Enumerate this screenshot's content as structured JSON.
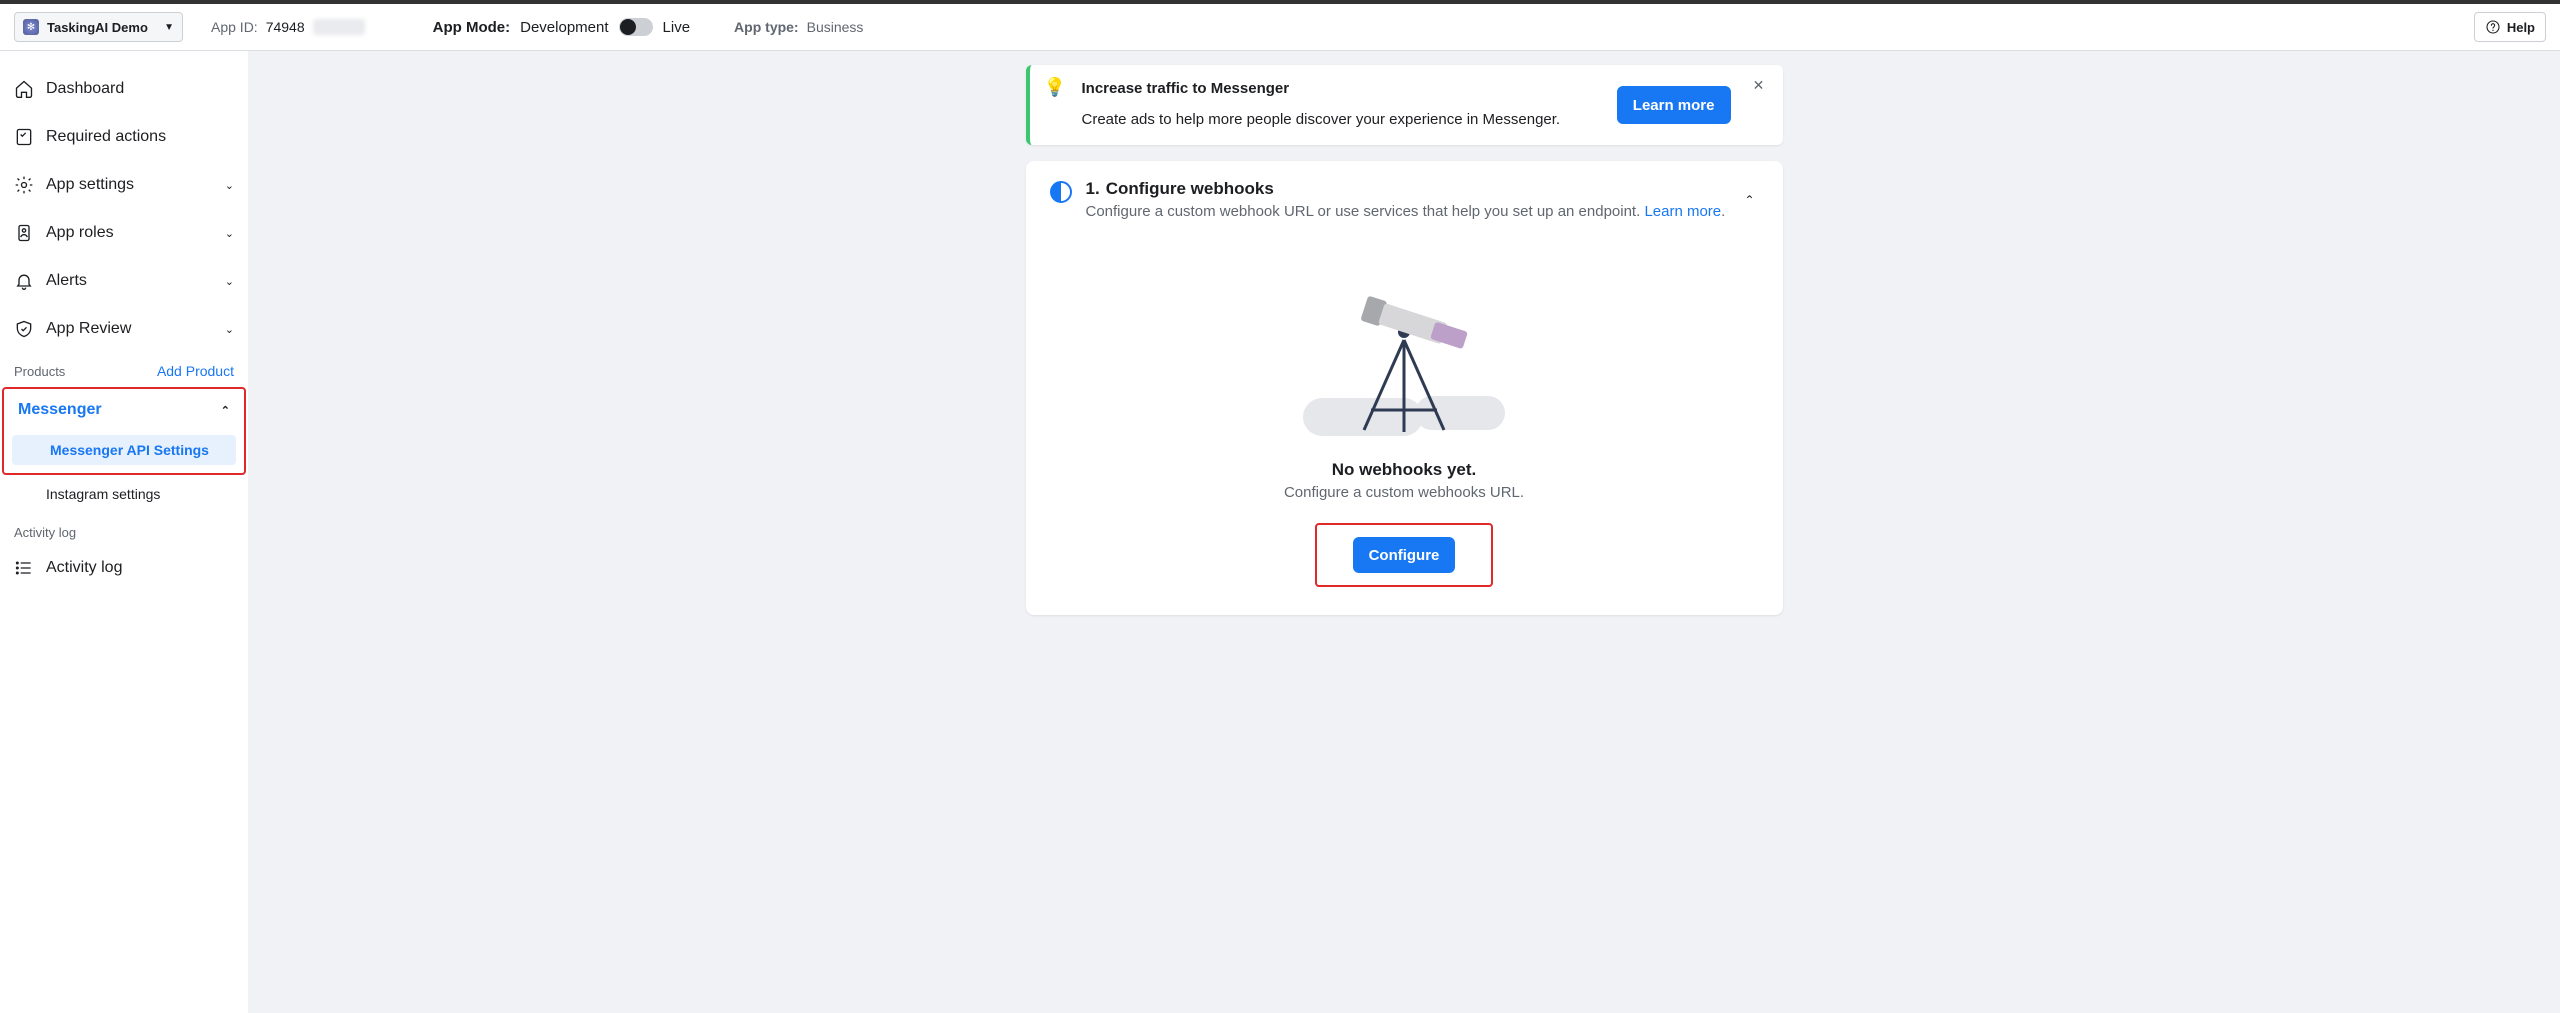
{
  "header": {
    "appName": "TaskingAI Demo",
    "appIdLabel": "App ID:",
    "appIdValue": "74948",
    "appModeLabel": "App Mode:",
    "modeDev": "Development",
    "modeLive": "Live",
    "appTypeLabel": "App type:",
    "appTypeValue": "Business",
    "help": "Help"
  },
  "sidebar": {
    "dashboard": "Dashboard",
    "requiredActions": "Required actions",
    "appSettings": "App settings",
    "appRoles": "App roles",
    "alerts": "Alerts",
    "appReview": "App Review",
    "productsHeading": "Products",
    "addProduct": "Add Product",
    "messenger": "Messenger",
    "messengerApi": "Messenger API Settings",
    "instagram": "Instagram settings",
    "activityHeading": "Activity log",
    "activityLog": "Activity log"
  },
  "banner": {
    "title": "Increase traffic to Messenger",
    "subtitle": "Create ads to help more people discover your experience in Messenger.",
    "cta": "Learn more"
  },
  "webhooks": {
    "stepNum": "1.",
    "title": "Configure webhooks",
    "desc": "Configure a custom webhook URL or use services that help you set up an endpoint. ",
    "learn": "Learn more",
    "emptyTitle": "No webhooks yet.",
    "emptySub": "Configure a custom webhooks URL.",
    "configure": "Configure"
  }
}
